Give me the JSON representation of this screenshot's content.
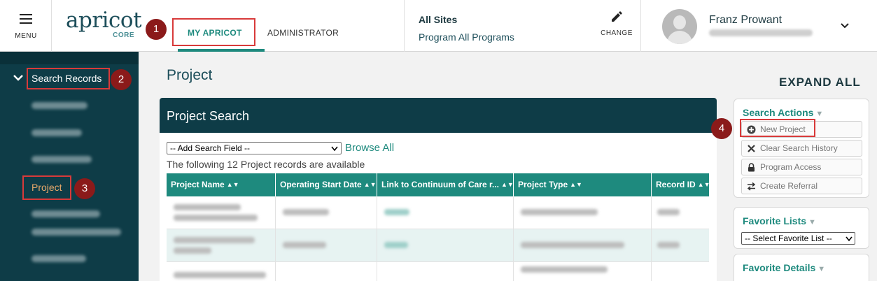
{
  "header": {
    "menu_label": "MENU",
    "logo_word": "apricot",
    "logo_core": "CORE",
    "tabs": [
      {
        "label": "MY APRICOT",
        "active": true
      },
      {
        "label": "ADMINISTRATOR",
        "active": false
      }
    ],
    "sites_title": "All Sites",
    "sites_program": "Program All Programs",
    "change_label": "CHANGE",
    "user_name": "Franz Prowant"
  },
  "callouts": [
    "1",
    "2",
    "3",
    "4"
  ],
  "sidebar": {
    "search_records": "Search Records",
    "project": "Project"
  },
  "main": {
    "page_title": "Project",
    "expand_all": "EXPAND ALL",
    "panel_title": "Project Search",
    "add_field_value": "-- Add Search Field --",
    "browse_all": "Browse All",
    "records_count": "The following 12 Project records are available",
    "columns": [
      "Project Name",
      "Operating Start Date",
      "Link to Continuum of Care r...",
      "Project Type",
      "Record ID"
    ]
  },
  "right": {
    "search_actions": {
      "title": "Search Actions",
      "buttons": [
        "New Project",
        "Clear Search History",
        "Program Access",
        "Create Referral"
      ]
    },
    "favorite_lists": {
      "title": "Favorite Lists",
      "select_value": "-- Select Favorite List --"
    },
    "favorite_details": {
      "title": "Favorite Details"
    }
  },
  "colors": {
    "teal": "#1e8a7e",
    "navy": "#0e3c47",
    "callout_red": "#d83a3a",
    "badge_red": "#8b1a1a",
    "sidebar_active": "#e8a86a"
  },
  "icons": [
    "menu-icon",
    "pencil-icon",
    "chevron-down-icon",
    "sort-icon",
    "plus-circle-icon",
    "x-icon",
    "lock-icon",
    "transfer-icon"
  ]
}
